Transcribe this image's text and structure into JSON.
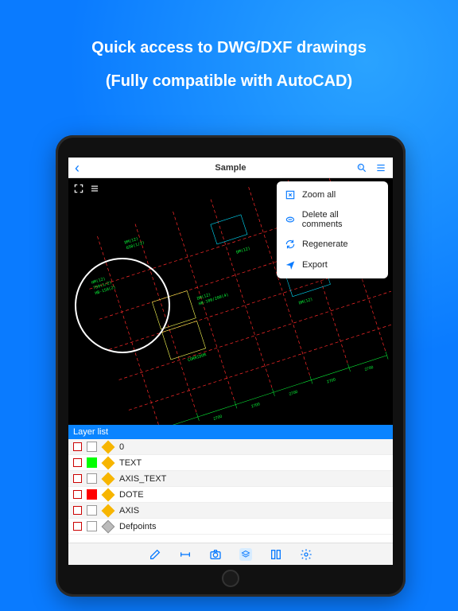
{
  "marketing": {
    "line1": "Quick access to DWG/DXF drawings",
    "line2": "(Fully compatible with AutoCAD)"
  },
  "topbar": {
    "back_glyph": "‹",
    "title": "Sample"
  },
  "menu": {
    "items": [
      {
        "icon": "zoom-all-icon",
        "label": "Zoom all"
      },
      {
        "icon": "delete-comments-icon",
        "label": "Delete all comments"
      },
      {
        "icon": "refresh-icon",
        "label": "Regenerate"
      },
      {
        "icon": "export-icon",
        "label": "Export"
      }
    ]
  },
  "layers": {
    "header": "Layer list",
    "rows": [
      {
        "color": "#ffffff",
        "name": "0",
        "diamond": "gold"
      },
      {
        "color": "#00ff00",
        "name": "TEXT",
        "diamond": "gold"
      },
      {
        "color": "#ffffff",
        "name": "AXIS_TEXT",
        "diamond": "gold"
      },
      {
        "color": "#ff0000",
        "name": "DOTE",
        "diamond": "gold"
      },
      {
        "color": "#ffffff",
        "name": "AXIS",
        "diamond": "gold"
      },
      {
        "color": "#ffffff",
        "name": "Defpoints",
        "diamond": "gray"
      }
    ]
  },
  "toolbar": {
    "items": [
      "edit-icon",
      "measure-icon",
      "camera-icon",
      "layers-icon",
      "columns-icon",
      "gear-icon"
    ]
  }
}
